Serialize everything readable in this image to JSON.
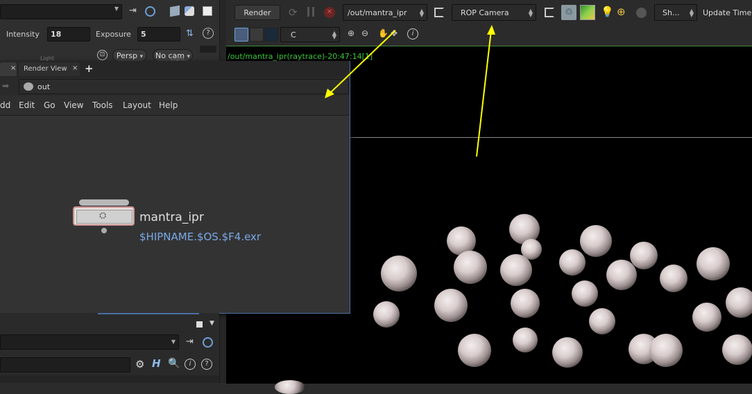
{
  "left_panel": {
    "intensity_label": "Intensity",
    "intensity_value": "18",
    "exposure_label": "Exposure",
    "exposure_value": "5",
    "persp_label": "Persp",
    "nocam_label": "No cam",
    "light_label_1": "Light",
    "light_label_2": "Light"
  },
  "net_pane": {
    "tab_render_view": "Render View",
    "path_value": "out",
    "menu": [
      "dd",
      "Edit",
      "Go",
      "View",
      "Tools",
      "Layout",
      "Help"
    ],
    "node_name": "mantra_ipr",
    "node_output": "$HIPNAME.$OS.$F4.exr"
  },
  "viewer": {
    "render_button": "Render",
    "rop_path": "/out/mantra_ipr",
    "camera_select": "ROP Camera",
    "sh_select": "Sh...",
    "update_time": "Update Time",
    "channel_select": "C",
    "status_text": "/out/mantra_ipr(raytrace)-20:47:14[1]"
  },
  "colors": {
    "accent_blue": "#4a6fa5",
    "annotation_yellow": "#ffff00",
    "status_green": "#38c938",
    "output_link": "#7aa9e6"
  }
}
